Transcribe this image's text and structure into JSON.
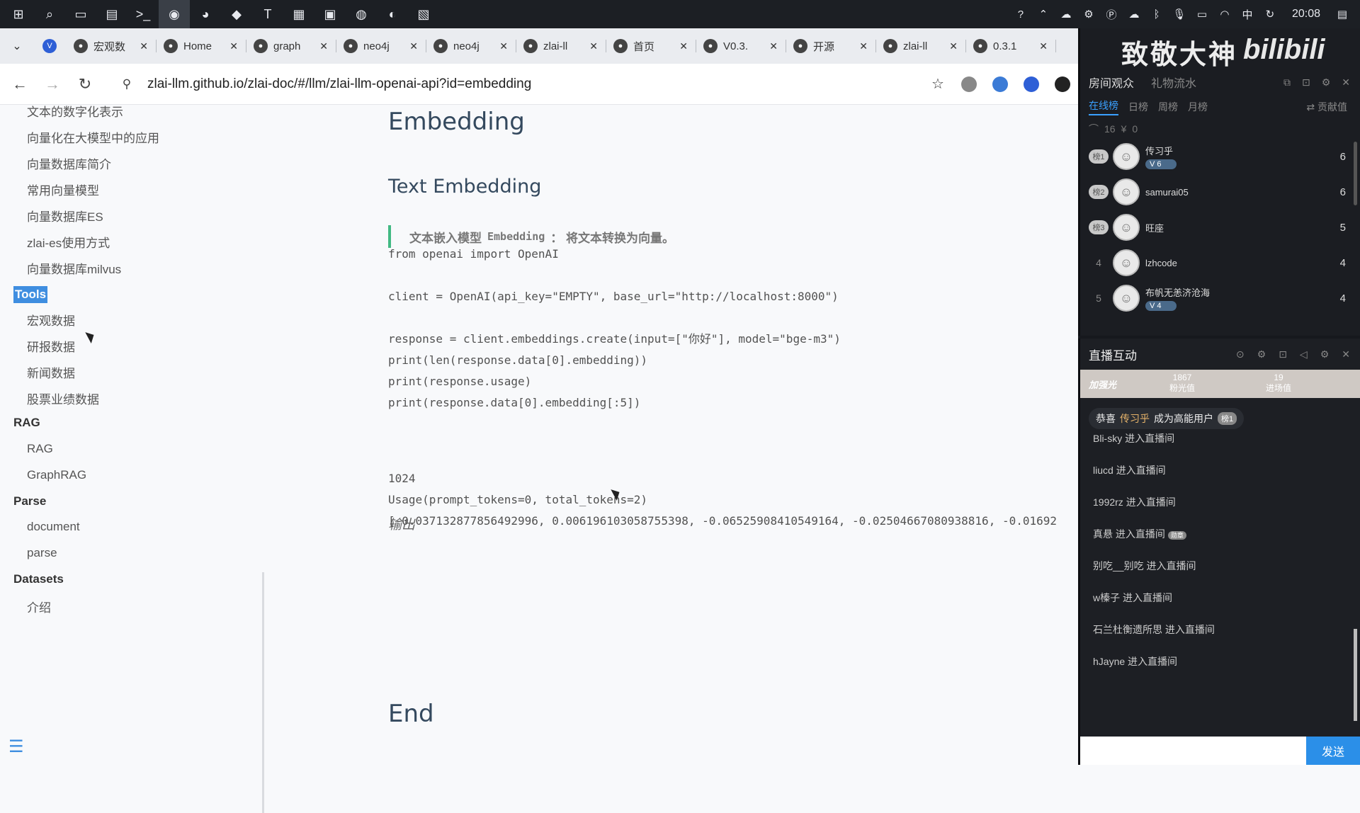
{
  "taskbar": {
    "apps": [
      "windows-start",
      "search",
      "task-view",
      "file-explorer",
      "terminal",
      "chrome",
      "wechat",
      "feishu",
      "typora",
      "notepad",
      "app-7",
      "chrome-2",
      "edge",
      "whiteboard"
    ],
    "tray_ime": "中",
    "time": "20:08"
  },
  "tabs": [
    {
      "title": "宏观数",
      "icon": "globe-icon"
    },
    {
      "title": "Home",
      "icon": "loading-icon"
    },
    {
      "title": "graph",
      "icon": "doc-icon"
    },
    {
      "title": "neo4j",
      "icon": "doc-icon"
    },
    {
      "title": "neo4j",
      "icon": "terminal-icon"
    },
    {
      "title": "zlai-ll",
      "icon": "github-icon"
    },
    {
      "title": "首页",
      "icon": "globe-icon"
    },
    {
      "title": "V0.3.",
      "icon": "github-icon"
    },
    {
      "title": "开源",
      "icon": "globe-icon"
    },
    {
      "title": "zlai-ll",
      "icon": "github-icon"
    },
    {
      "title": "0.3.1",
      "icon": "loading-icon"
    }
  ],
  "address": {
    "url": "zlai-llm.github.io/zlai-doc/#/llm/zlai-llm-openai-api?id=embedding"
  },
  "sidebar": {
    "items": [
      {
        "label": "文本的数字化表示",
        "kind": "sub"
      },
      {
        "label": "向量化在大模型中的应用",
        "kind": "sub"
      },
      {
        "label": "向量数据库简介",
        "kind": "sub"
      },
      {
        "label": "常用向量模型",
        "kind": "sub"
      },
      {
        "label": "向量数据库ES",
        "kind": "sub"
      },
      {
        "label": "zlai-es使用方式",
        "kind": "sub"
      },
      {
        "label": "向量数据库milvus",
        "kind": "sub"
      },
      {
        "label": "Tools",
        "kind": "group-selected"
      },
      {
        "label": "宏观数据",
        "kind": "sub"
      },
      {
        "label": "研报数据",
        "kind": "sub"
      },
      {
        "label": "新闻数据",
        "kind": "sub"
      },
      {
        "label": "股票业绩数据",
        "kind": "sub"
      },
      {
        "label": "RAG",
        "kind": "group"
      },
      {
        "label": "RAG",
        "kind": "sub"
      },
      {
        "label": "GraphRAG",
        "kind": "sub"
      },
      {
        "label": "Parse",
        "kind": "group"
      },
      {
        "label": "document",
        "kind": "sub"
      },
      {
        "label": "parse",
        "kind": "sub"
      },
      {
        "label": "Datasets",
        "kind": "group"
      },
      {
        "label": "介绍",
        "kind": "sub"
      }
    ]
  },
  "content": {
    "h1": "Embedding",
    "h2": "Text Embedding",
    "quote_pre": "文本嵌入模型",
    "quote_code": "Embedding",
    "quote_post": "： 将文本转换为向量。",
    "code_lines": [
      "from openai import OpenAI",
      "",
      "client = OpenAI(api_key=\"EMPTY\", base_url=\"http://localhost:8000\")",
      "",
      "response = client.embeddings.create(input=[\"你好\"], model=\"bge-m3\")",
      "print(len(response.data[0].embedding))",
      "print(response.usage)",
      "print(response.data[0].embedding[:5])"
    ],
    "output_label": "输出",
    "output_lines": [
      "1024",
      "Usage(prompt_tokens=0, total_tokens=2)",
      "[-0.037132877856492996, 0.006196103058755398, -0.06525908410549164, -0.02504667080938816, -0.01692"
    ],
    "end": "End"
  },
  "live": {
    "banner": "致敬大神",
    "banner_logo": "bilibili",
    "tabs": {
      "audience": "房间观众",
      "gifts": "礼物流水"
    },
    "rank_tabs": [
      "在线榜",
      "日榜",
      "周榜",
      "月榜"
    ],
    "contrib_label": "⇄ 贡献值",
    "online_count": "16",
    "coins": "0",
    "viewers": [
      {
        "rank": "榜1",
        "name": "传习乎",
        "badge": "6",
        "score": "6"
      },
      {
        "rank": "榜2",
        "name": "samurai05",
        "badge": "",
        "score": "6"
      },
      {
        "rank": "榜3",
        "name": "旺座",
        "badge": "",
        "score": "5"
      },
      {
        "rank": "4",
        "name": "lzhcode",
        "badge": "",
        "score": "4"
      },
      {
        "rank": "5",
        "name": "布帆无恙济沧海",
        "badge": "4",
        "score": "4"
      }
    ],
    "interact_title": "直播互动",
    "glow": {
      "label": "加强光",
      "n1": "1867",
      "l1": "粉光值",
      "n2": "19",
      "l2": "进场值"
    },
    "congrats": {
      "pre": "恭喜",
      "user": "传习乎",
      "post": "成为高能用户",
      "tag": "榜1"
    },
    "messages": [
      {
        "user": "Bli-sky",
        "action": "进入直播间",
        "medal": ""
      },
      {
        "user": "liucd",
        "action": "进入直播间",
        "medal": ""
      },
      {
        "user": "1992rz",
        "action": "进入直播间",
        "medal": ""
      },
      {
        "user": "真悬",
        "action": "进入直播间",
        "medal": "勋章"
      },
      {
        "user": "别吃__别吃",
        "action": "进入直播间",
        "medal": ""
      },
      {
        "user": "w榛子",
        "action": "进入直播间",
        "medal": ""
      },
      {
        "user": "石兰杜衡遗所思",
        "action": "进入直播间",
        "medal": ""
      },
      {
        "user": "hJayne",
        "action": "进入直播间",
        "medal": ""
      }
    ],
    "send_label": "发送",
    "input_value": ""
  }
}
